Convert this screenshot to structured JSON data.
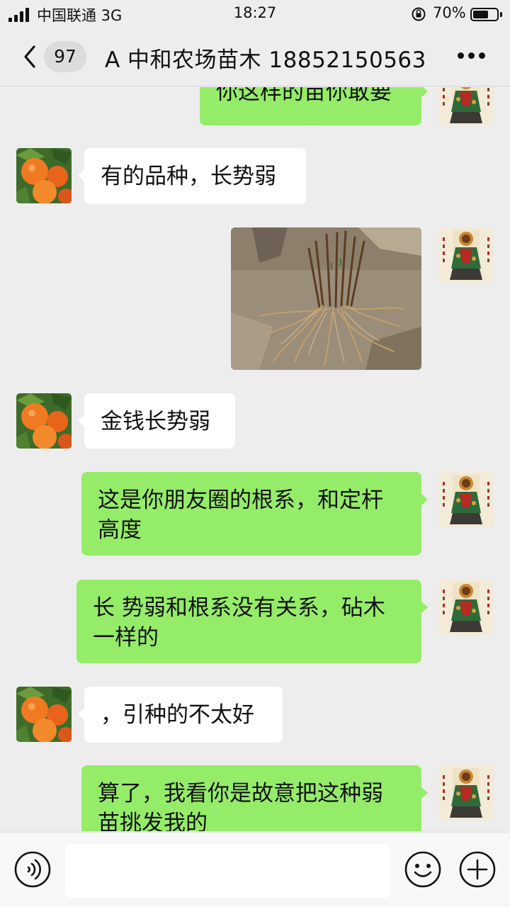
{
  "status_bar": {
    "carrier": "中国联通 3G",
    "time": "18:27",
    "battery": "70%",
    "battery_level": 0.7
  },
  "header": {
    "back_icon": "chevron-left-icon",
    "unread_count": "97",
    "title": "A 中和农场苗木 18852150563",
    "more_icon": "more-dots-icon"
  },
  "messages": [
    {
      "from": "me",
      "type": "text",
      "text": "你这样的苗你敢要"
    },
    {
      "from": "contact",
      "type": "text",
      "text": "有的品种，长势弱"
    },
    {
      "from": "me",
      "type": "image",
      "image": "seedling-roots-photo"
    },
    {
      "from": "contact",
      "type": "text",
      "text": "金钱长势弱"
    },
    {
      "from": "me",
      "type": "text",
      "lines": [
        "这是你朋友圈的根系，和定杆",
        "高度"
      ]
    },
    {
      "from": "me",
      "type": "text",
      "lines": [
        "长 势弱和根系没有关系，砧木",
        "一样的"
      ]
    },
    {
      "from": "contact",
      "type": "text",
      "text": "，引种的不太好"
    },
    {
      "from": "me",
      "type": "text",
      "lines": [
        "算了，我看你是故意把这种弱",
        "苗挑发我的"
      ]
    }
  ],
  "avatars": {
    "contact": "orange-fruit-avatar",
    "me": "warrior-painting-avatar"
  },
  "input_bar": {
    "voice_icon": "voice-input-icon",
    "message_value": "",
    "emoji_icon": "emoji-icon",
    "plus_icon": "plus-icon"
  },
  "colors": {
    "background": "#ededed",
    "outgoing_bubble": "#95ec69",
    "incoming_bubble": "#ffffff"
  }
}
